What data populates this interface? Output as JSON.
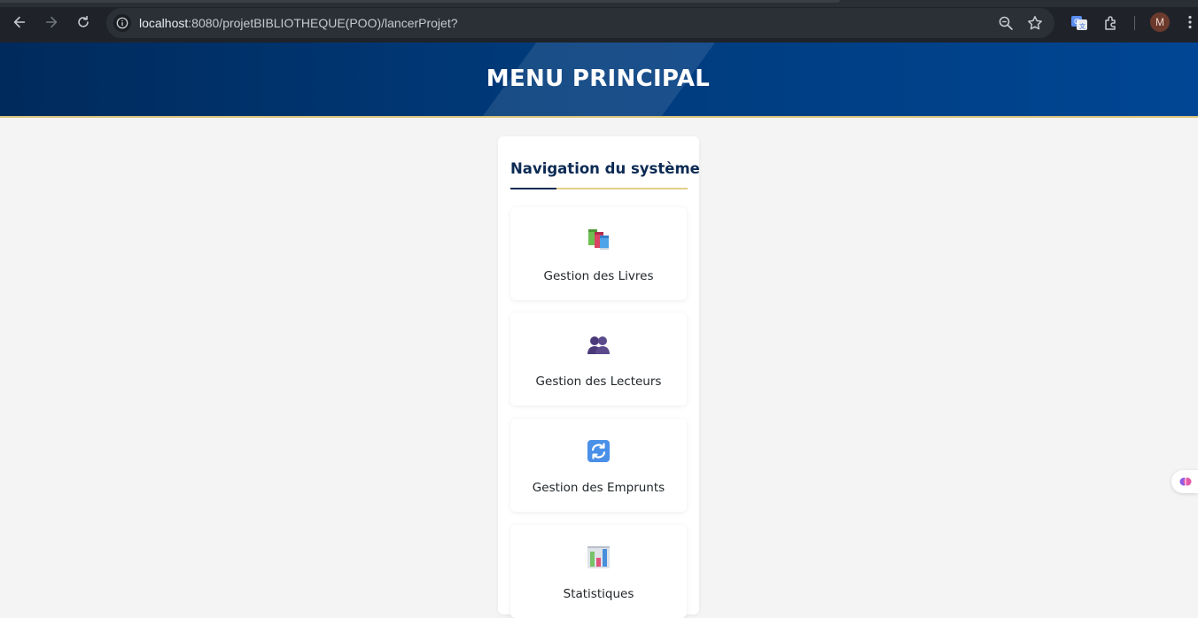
{
  "browser": {
    "url_host": "localhost",
    "url_path": ":8080/projetBIBLIOTHEQUE(POO)/lancerProjet?",
    "profile_initial": "M",
    "icons": [
      "back-icon",
      "forward-icon",
      "reload-icon",
      "site-info-icon",
      "zoom-icon",
      "bookmark-star-icon",
      "translate-icon",
      "extensions-icon",
      "menu-icon"
    ]
  },
  "header": {
    "title": "MENU PRINCIPAL"
  },
  "nav": {
    "title": "Navigation du système",
    "items": [
      {
        "label": "Gestion des Livres",
        "icon": "books-icon"
      },
      {
        "label": "Gestion des Lecteurs",
        "icon": "readers-icon"
      },
      {
        "label": "Gestion des Emprunts",
        "icon": "loans-icon"
      },
      {
        "label": "Statistiques",
        "icon": "statistics-icon"
      }
    ]
  },
  "colors": {
    "header_bg": "#003a7a",
    "nav_title": "#0c2a54",
    "gold_accent": "#e4cf8a",
    "page_bg": "#f4f4f4"
  }
}
